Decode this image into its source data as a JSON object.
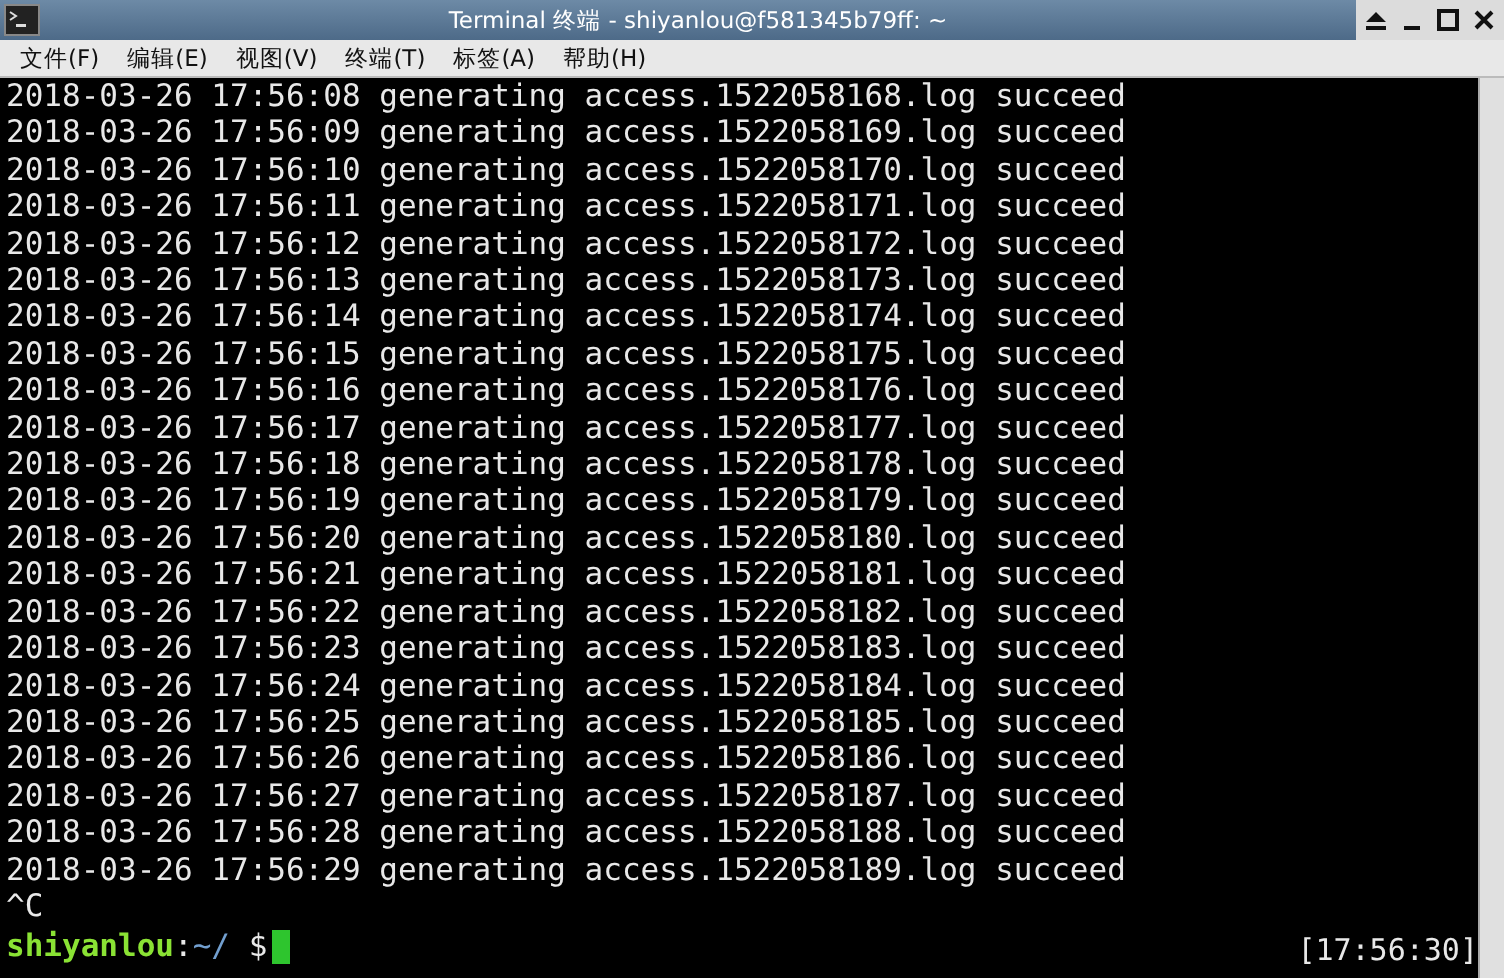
{
  "window": {
    "title": "Terminal 终端 - shiyanlou@f581345b79ff: ~"
  },
  "menu": [
    "文件(F)",
    "编辑(E)",
    "视图(V)",
    "终端(T)",
    "标签(A)",
    "帮助(H)"
  ],
  "terminal": {
    "lines": [
      "2018-03-26 17:56:08 generating access.1522058168.log succeed",
      "2018-03-26 17:56:09 generating access.1522058169.log succeed",
      "2018-03-26 17:56:10 generating access.1522058170.log succeed",
      "2018-03-26 17:56:11 generating access.1522058171.log succeed",
      "2018-03-26 17:56:12 generating access.1522058172.log succeed",
      "2018-03-26 17:56:13 generating access.1522058173.log succeed",
      "2018-03-26 17:56:14 generating access.1522058174.log succeed",
      "2018-03-26 17:56:15 generating access.1522058175.log succeed",
      "2018-03-26 17:56:16 generating access.1522058176.log succeed",
      "2018-03-26 17:56:17 generating access.1522058177.log succeed",
      "2018-03-26 17:56:18 generating access.1522058178.log succeed",
      "2018-03-26 17:56:19 generating access.1522058179.log succeed",
      "2018-03-26 17:56:20 generating access.1522058180.log succeed",
      "2018-03-26 17:56:21 generating access.1522058181.log succeed",
      "2018-03-26 17:56:22 generating access.1522058182.log succeed",
      "2018-03-26 17:56:23 generating access.1522058183.log succeed",
      "2018-03-26 17:56:24 generating access.1522058184.log succeed",
      "2018-03-26 17:56:25 generating access.1522058185.log succeed",
      "2018-03-26 17:56:26 generating access.1522058186.log succeed",
      "2018-03-26 17:56:27 generating access.1522058187.log succeed",
      "2018-03-26 17:56:28 generating access.1522058188.log succeed",
      "2018-03-26 17:56:29 generating access.1522058189.log succeed",
      "^C"
    ],
    "prompt": {
      "user": "shiyanlou",
      "separator": ":",
      "path": "~/",
      "symbol": "$"
    },
    "clock": "[17:56:30]"
  }
}
